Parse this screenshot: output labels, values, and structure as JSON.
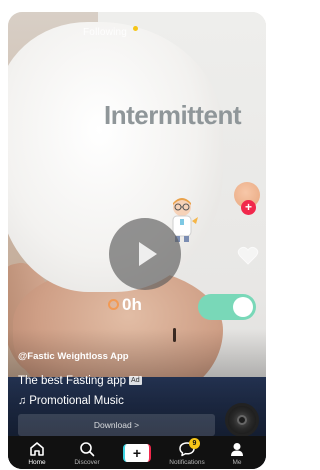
{
  "header": {
    "following_label": "Following"
  },
  "video": {
    "headline": "Intermittent",
    "timer_text": "0h",
    "author": "@Fastic Weightloss App",
    "caption": "The best Fasting app",
    "ad_badge": "Ad",
    "music": "Promotional Music",
    "download_label": "Download >"
  },
  "actions": {
    "avatar_plus": "+",
    "icons": [
      "avatar",
      "follow-plus-icon",
      "heart-icon",
      "play-icon",
      "music-disc"
    ]
  },
  "tabbar": {
    "home": "Home",
    "discover": "Discover",
    "create": "+",
    "notifications": "Notifications",
    "notifications_badge": "9",
    "me": "Me"
  },
  "colors": {
    "accent_red": "#f1284c",
    "accent_cyan": "#3cd3e2",
    "toggle_green": "#79d8b8",
    "badge_yellow": "#f5c518",
    "tabbar_bg": "#111111"
  }
}
